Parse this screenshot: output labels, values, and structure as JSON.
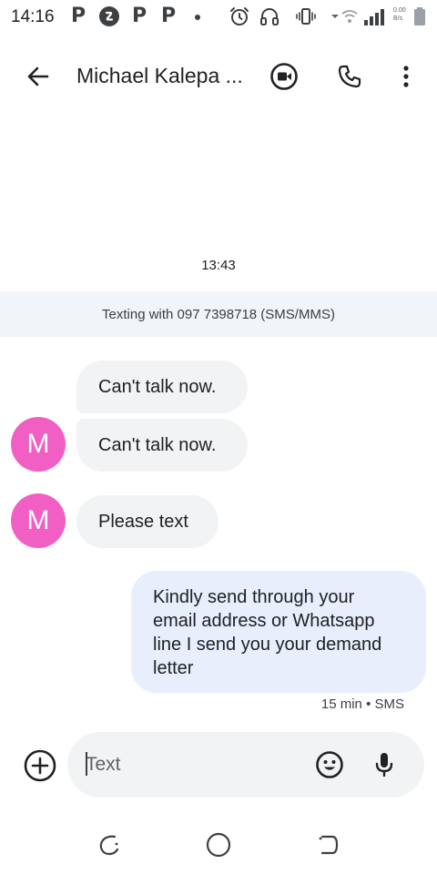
{
  "status_bar": {
    "time": "14:16",
    "app_icons": [
      "p-notification-icon",
      "shazam-icon",
      "p-notification-icon",
      "p-notification-icon",
      "dot-icon"
    ],
    "p_glyph": "P",
    "system_icons": [
      "alarm-icon",
      "headset-icon",
      "vibrate-icon",
      "wifi-icon",
      "signal-icon",
      "battery-icon"
    ],
    "net_speed_value": "0.00",
    "net_speed_unit": "B/s"
  },
  "app_bar": {
    "contact_name": "Michael Kalepa ...",
    "icons": [
      "back-arrow-icon",
      "video-call-icon",
      "phone-icon",
      "more-vert-icon"
    ]
  },
  "conversation": {
    "timestamp": "13:43",
    "texting_banner": "Texting with 097 7398718 (SMS/MMS)",
    "incoming": [
      {
        "text": "Can't talk now.",
        "avatar": ""
      },
      {
        "text": "Can't talk now.",
        "avatar": "M"
      },
      {
        "text": "Please text",
        "avatar": "M"
      }
    ],
    "outgoing": [
      {
        "lines": [
          "Kindly send through your",
          "email address or Whatsapp",
          "line I send you your demand",
          "letter"
        ],
        "meta": "15 min • SMS"
      }
    ]
  },
  "compose": {
    "placeholder": "Text",
    "icons": [
      "add-circle-icon",
      "emoji-icon",
      "mic-icon"
    ]
  },
  "nav_bar": {
    "icons": [
      "recents-icon",
      "home-icon",
      "back-icon"
    ]
  },
  "colors": {
    "incoming_bubble": "#f1f3f4",
    "outgoing_bubble": "#e8eefc",
    "avatar": "#f25fc4",
    "banner": "#f1f4f8"
  }
}
